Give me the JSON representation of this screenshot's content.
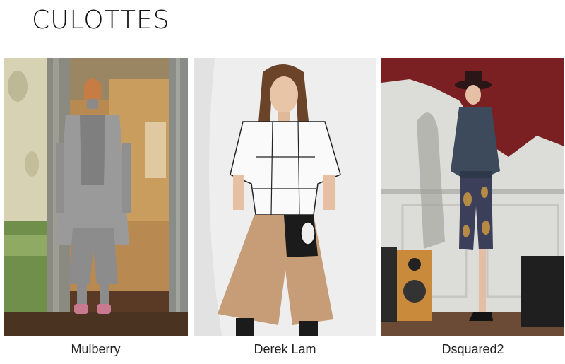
{
  "page": {
    "title": "CULOTTES"
  },
  "looks": [
    {
      "designer": "Mulberry",
      "photo": "model-in-grey-coat-and-culottes-in-doorway"
    },
    {
      "designer": "Derek Lam",
      "photo": "model-in-white-grid-top-and-camel-culottes"
    },
    {
      "designer": "Dsquared2",
      "photo": "model-in-hat-and-brocade-culottes-by-red-wall"
    }
  ]
}
